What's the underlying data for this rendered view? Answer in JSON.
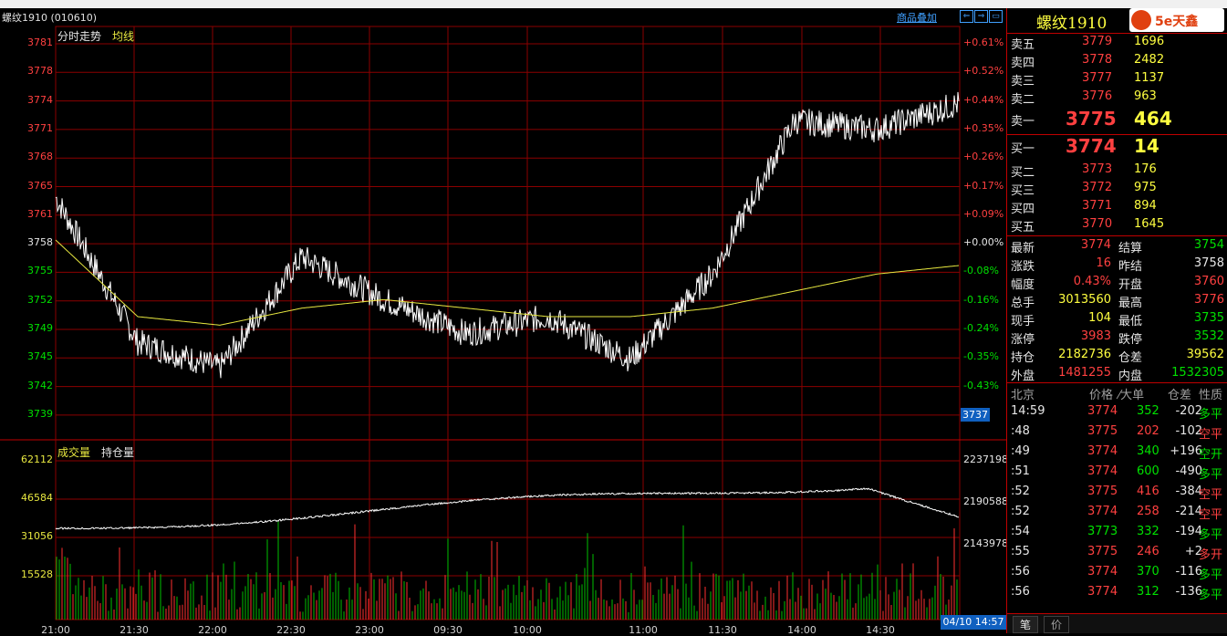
{
  "menubar": {
    "items": [
      "",
      "",
      "",
      "",
      "",
      "",
      "",
      "",
      "",
      ""
    ]
  },
  "header": {
    "instrument": "螺纹1910 (010610)",
    "overlay_button": "商品叠加",
    "panel_title": "螺纹1910",
    "logo_text": "5e天鑫"
  },
  "chart": {
    "title_minute": "分时走势",
    "title_avg": "均线",
    "price_labels": [
      "3781",
      "3778",
      "3774",
      "3771",
      "3768",
      "3765",
      "3761",
      "3758",
      "3755",
      "3752",
      "3749",
      "3745",
      "3742",
      "3739"
    ],
    "pct_labels": [
      "+0.61%",
      "+0.52%",
      "+0.44%",
      "+0.35%",
      "+0.26%",
      "+0.17%",
      "+0.09%",
      "+0.00%",
      "-0.08%",
      "-0.16%",
      "-0.24%",
      "-0.35%",
      "-0.43%"
    ],
    "last_price_tag": "3737",
    "vol_title": "成交量",
    "oi_title": "持仓量",
    "vol_labels": [
      "62112",
      "46584",
      "31056",
      "15528"
    ],
    "oi_labels": [
      "2237198",
      "2190588",
      "2143978"
    ],
    "time_labels": [
      "21:00",
      "21:30",
      "22:00",
      "22:30",
      "23:00",
      "09:30",
      "10:00",
      "11:00",
      "11:30",
      "14:00",
      "14:30"
    ],
    "datetime": "04/10 14:57",
    "colors": {
      "grid": "#8b0000",
      "price_line": "#ffffff",
      "avg_line": "#e8e840",
      "up": "#ff3030",
      "down": "#00c000",
      "oi_line": "#ffffff"
    }
  },
  "chart_data": {
    "type": "line",
    "x": [
      "21:00",
      "21:30",
      "22:00",
      "22:30",
      "23:00",
      "09:30",
      "10:00",
      "11:00",
      "11:30",
      "14:00",
      "14:30",
      "14:59"
    ],
    "series": [
      {
        "name": "",
        "values": [
          3763,
          3746,
          3743,
          3756,
          3751,
          3747,
          3749,
          3744,
          3754,
          3772,
          3771,
          3774
        ]
      },
      {
        "name": "均线",
        "values": [
          3758,
          3749,
          3748,
          3750,
          3751,
          3750,
          3749,
          3749,
          3750,
          3752,
          3754,
          3755
        ]
      }
    ],
    "ylim": [
      3737,
      3782
    ]
  },
  "quote": {
    "sell": [
      {
        "label": "卖五",
        "price": "3779",
        "vol": "1696"
      },
      {
        "label": "卖四",
        "price": "3778",
        "vol": "2482"
      },
      {
        "label": "卖三",
        "price": "3777",
        "vol": "1137"
      },
      {
        "label": "卖二",
        "price": "3776",
        "vol": "963"
      },
      {
        "label": "卖一",
        "price": "3775",
        "vol": "464"
      }
    ],
    "buy": [
      {
        "label": "买一",
        "price": "3774",
        "vol": "14"
      },
      {
        "label": "买二",
        "price": "3773",
        "vol": "176"
      },
      {
        "label": "买三",
        "price": "3772",
        "vol": "975"
      },
      {
        "label": "买四",
        "price": "3771",
        "vol": "894"
      },
      {
        "label": "买五",
        "price": "3770",
        "vol": "1645"
      }
    ],
    "stats": [
      {
        "l1": "最新",
        "v1": "3774",
        "l2": "结算",
        "v2": "3754"
      },
      {
        "l1": "涨跌",
        "v1": "16",
        "l2": "昨结",
        "v2": "3758"
      },
      {
        "l1": "幅度",
        "v1": "0.43%",
        "l2": "开盘",
        "v2": "3760"
      },
      {
        "l1": "总手",
        "v1": "3013560",
        "l2": "最高",
        "v2": "3776"
      },
      {
        "l1": "现手",
        "v1": "104",
        "l2": "最低",
        "v2": "3735"
      },
      {
        "l1": "涨停",
        "v1": "3983",
        "l2": "跌停",
        "v2": "3532"
      },
      {
        "l1": "持仓",
        "v1": "2182736",
        "l2": "仓差",
        "v2": "39562"
      },
      {
        "l1": "外盘",
        "v1": "1481255",
        "l2": "内盘",
        "v2": "1532305"
      }
    ],
    "ticks_header": {
      "c1": "北京",
      "c2": "价格",
      "c3": "大单",
      "c4": "仓差",
      "c5": "性质"
    },
    "ticks": [
      {
        "t": "14:59",
        "p": "3774",
        "v": "352",
        "d": "-202",
        "k": "多平"
      },
      {
        "t": ":48",
        "p": "3775",
        "v": "202",
        "d": "-102",
        "k": "空平"
      },
      {
        "t": ":49",
        "p": "3774",
        "v": "340",
        "d": "+196",
        "k": "空开"
      },
      {
        "t": ":51",
        "p": "3774",
        "v": "600",
        "d": "-490",
        "k": "多平"
      },
      {
        "t": ":52",
        "p": "3775",
        "v": "416",
        "d": "-384",
        "k": "空平"
      },
      {
        "t": ":52",
        "p": "3774",
        "v": "258",
        "d": "-214",
        "k": "空平"
      },
      {
        "t": ":54",
        "p": "3773",
        "v": "332",
        "d": "-194",
        "k": "多平"
      },
      {
        "t": ":55",
        "p": "3775",
        "v": "246",
        "d": "+2",
        "k": "多开"
      },
      {
        "t": ":56",
        "p": "3774",
        "v": "370",
        "d": "-116",
        "k": "多平"
      },
      {
        "t": ":56",
        "p": "3774",
        "v": "312",
        "d": "-136",
        "k": "多平"
      }
    ],
    "bottom_tabs": [
      "笔",
      "价"
    ]
  }
}
